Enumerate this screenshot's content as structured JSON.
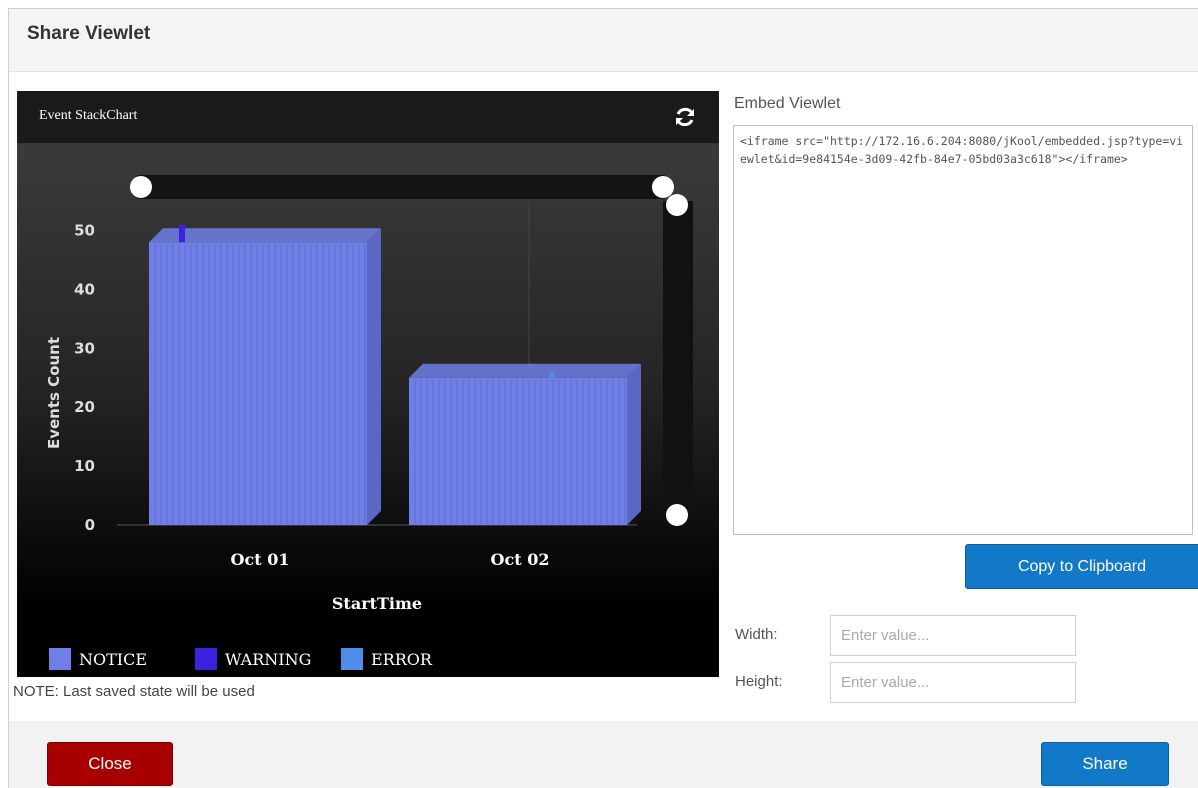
{
  "dialog": {
    "title": "Share Viewlet",
    "note": "NOTE: Last saved state will be used",
    "close_label": "Close",
    "share_label": "Share"
  },
  "chart_panel": {
    "title": "Event StackChart",
    "icon": "refresh-icon"
  },
  "embed": {
    "label": "Embed Viewlet",
    "code": "<iframe src=\"http://172.16.6.204:8080/jKool/embedded.jsp?type=viewlet&id=9e84154e-3d09-42fb-84e7-05bd03a3c618\"></iframe>",
    "copy_label": "Copy to Clipboard",
    "width_label": "Width:",
    "width_placeholder": "Enter value...",
    "height_label": "Height:",
    "height_placeholder": "Enter value..."
  },
  "colors": {
    "notice": "#6f7fe6",
    "warning": "#3a22e0",
    "error": "#4f8ee8",
    "close_button": "#a80000",
    "primary_button": "#1179c7"
  },
  "chart_data": {
    "type": "bar",
    "stacked": true,
    "xlabel": "StartTime",
    "ylabel": "Events Count",
    "ylim": [
      0,
      55
    ],
    "yticks": [
      0,
      10,
      20,
      30,
      40,
      50
    ],
    "categories": [
      "Oct 01",
      "Oct 02"
    ],
    "series": [
      {
        "name": "NOTICE",
        "values": [
          48,
          25
        ]
      },
      {
        "name": "WARNING",
        "values": [
          3,
          0
        ]
      },
      {
        "name": "ERROR",
        "values": [
          0,
          1
        ]
      }
    ],
    "legend": "bottom-left"
  }
}
